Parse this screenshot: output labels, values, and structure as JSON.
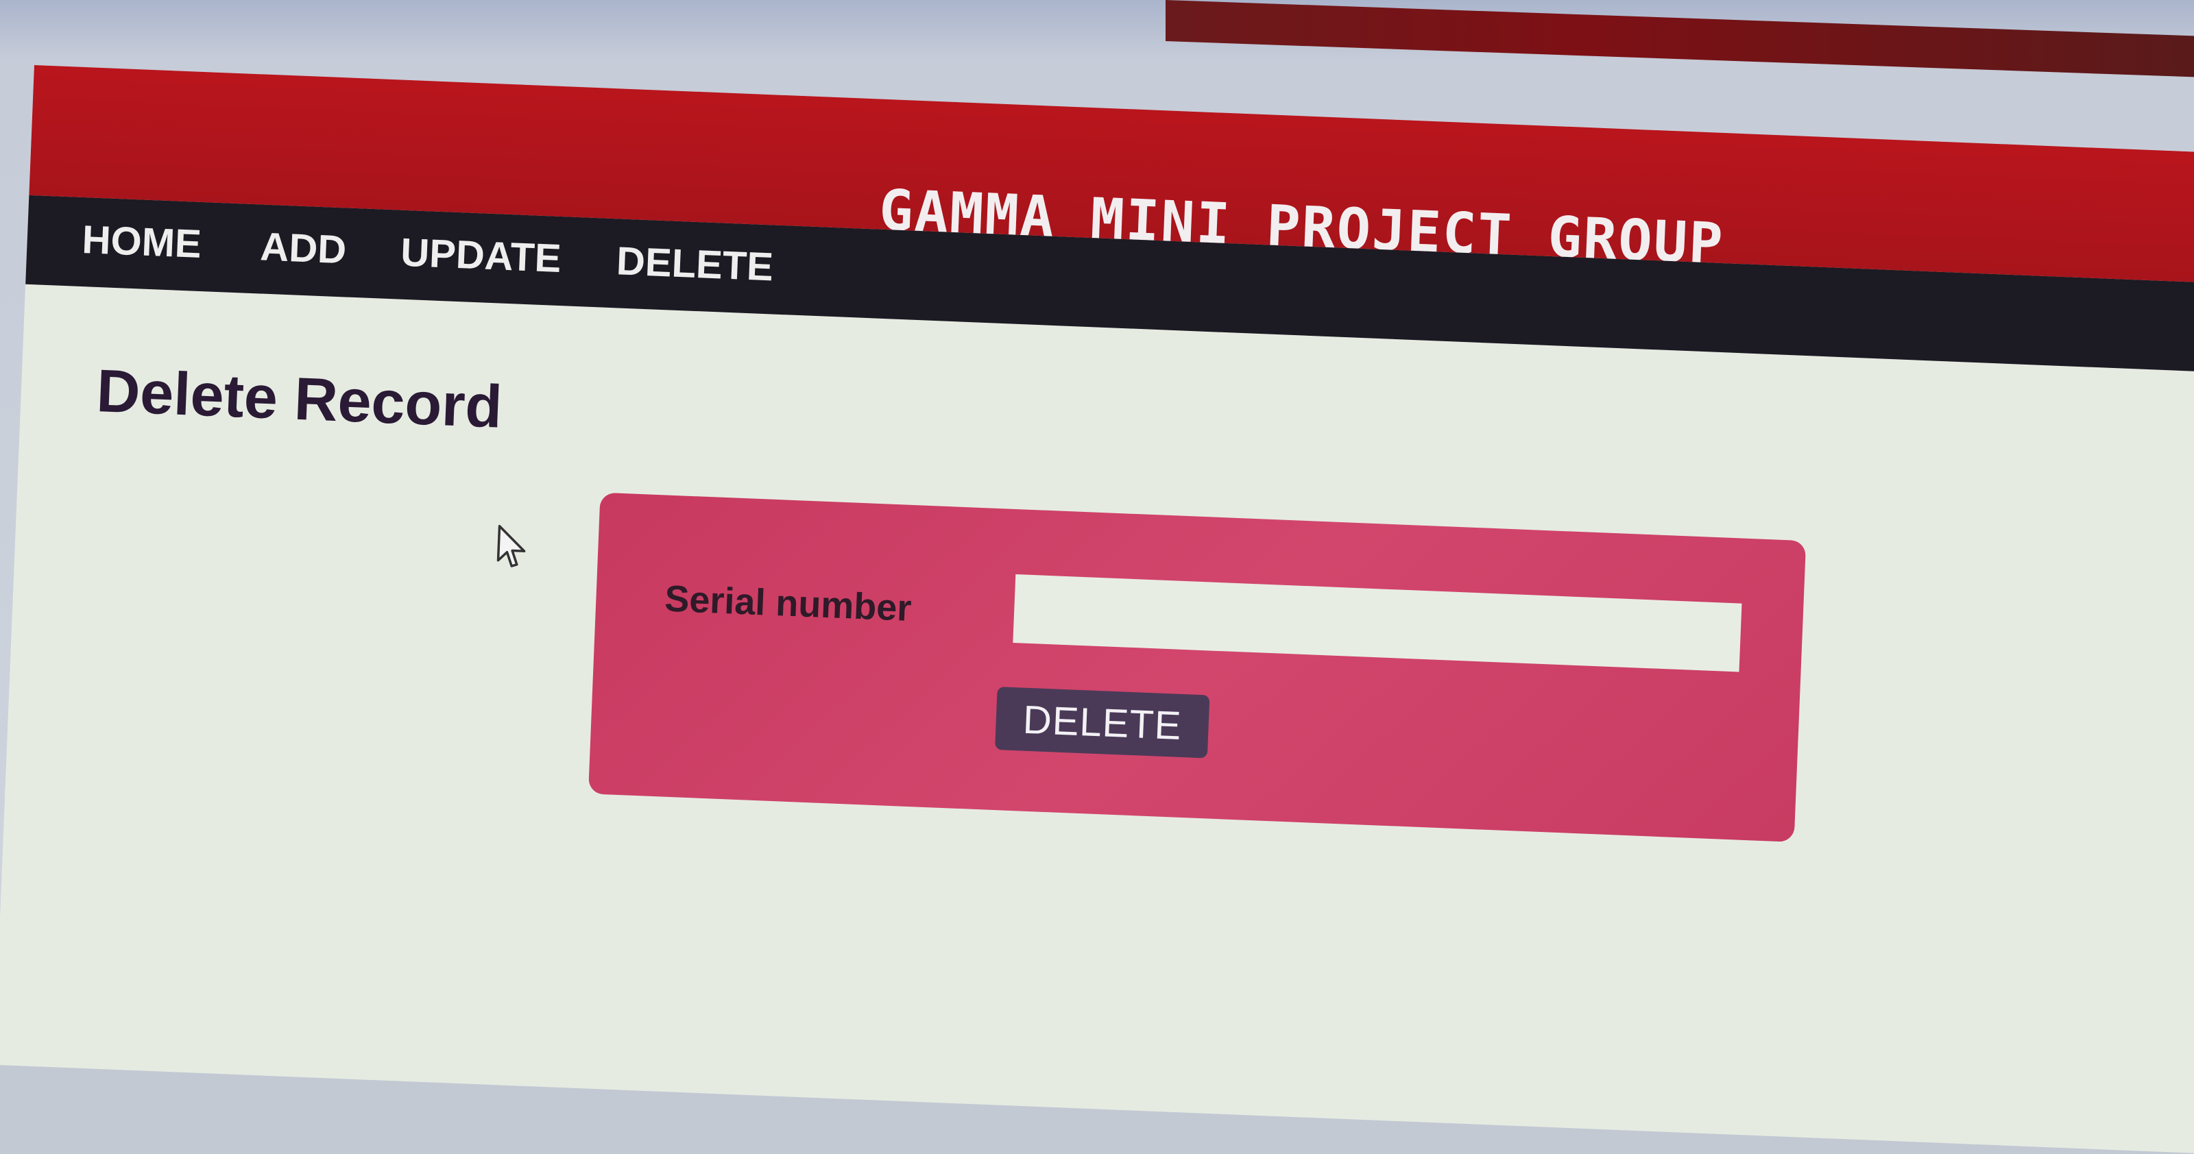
{
  "header": {
    "title": "GAMMA MINI PROJECT GROUP",
    "title_color": "#f2eef0",
    "bar_color": "#b9151d"
  },
  "nav": {
    "background": "#1c1a22",
    "items": [
      {
        "label": "HOME"
      },
      {
        "label": "ADD"
      },
      {
        "label": "UPDATE"
      },
      {
        "label": "DELETE"
      }
    ]
  },
  "main": {
    "heading": "Delete Record",
    "form": {
      "panel_color": "#cf4069",
      "serial_label": "Serial number",
      "serial_value": "",
      "serial_placeholder": "",
      "submit_label": "DELETE",
      "submit_color": "#4a3a58"
    }
  },
  "cursor": {
    "icon": "arrow-pointer-icon"
  }
}
